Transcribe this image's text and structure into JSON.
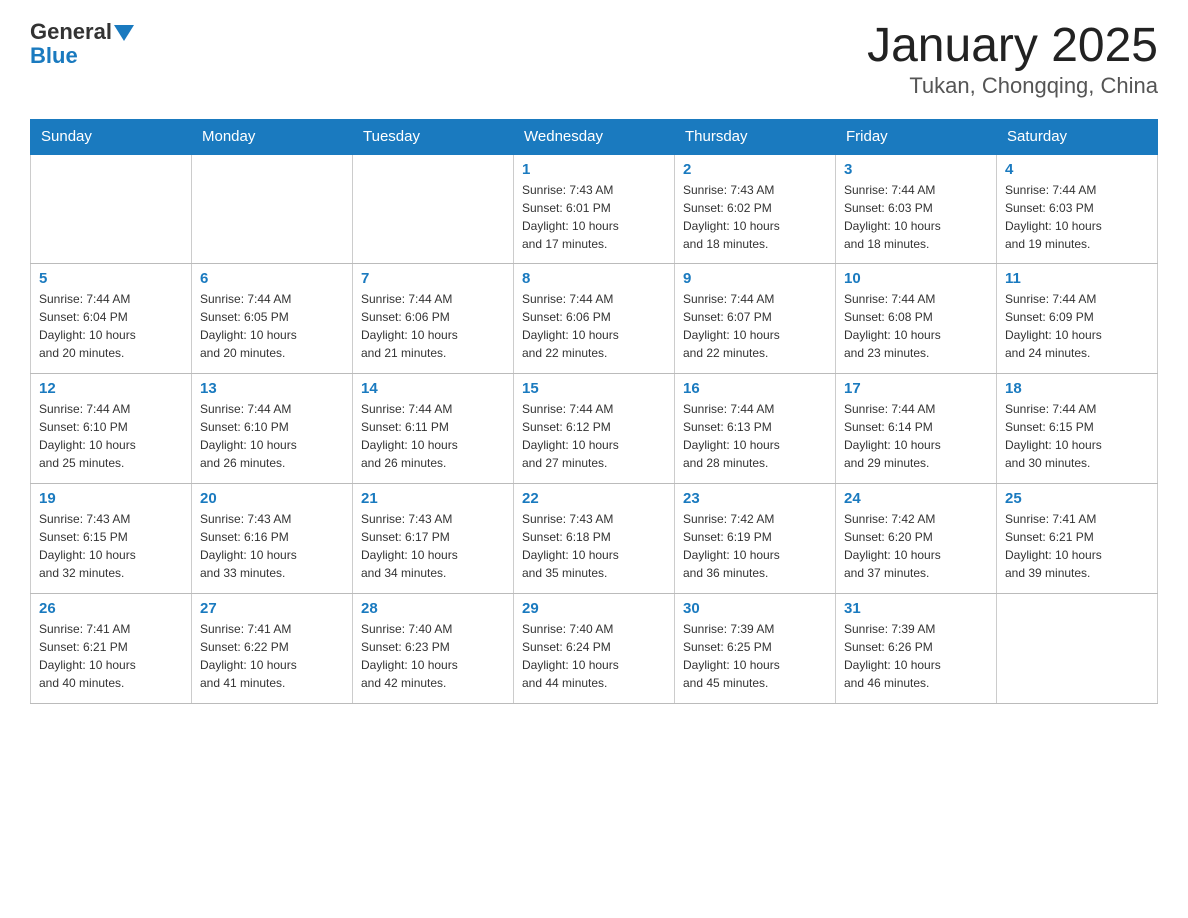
{
  "header": {
    "logo_general": "General",
    "logo_blue": "Blue",
    "title": "January 2025",
    "subtitle": "Tukan, Chongqing, China"
  },
  "weekdays": [
    "Sunday",
    "Monday",
    "Tuesday",
    "Wednesday",
    "Thursday",
    "Friday",
    "Saturday"
  ],
  "weeks": [
    [
      {
        "day": "",
        "info": ""
      },
      {
        "day": "",
        "info": ""
      },
      {
        "day": "",
        "info": ""
      },
      {
        "day": "1",
        "info": "Sunrise: 7:43 AM\nSunset: 6:01 PM\nDaylight: 10 hours\nand 17 minutes."
      },
      {
        "day": "2",
        "info": "Sunrise: 7:43 AM\nSunset: 6:02 PM\nDaylight: 10 hours\nand 18 minutes."
      },
      {
        "day": "3",
        "info": "Sunrise: 7:44 AM\nSunset: 6:03 PM\nDaylight: 10 hours\nand 18 minutes."
      },
      {
        "day": "4",
        "info": "Sunrise: 7:44 AM\nSunset: 6:03 PM\nDaylight: 10 hours\nand 19 minutes."
      }
    ],
    [
      {
        "day": "5",
        "info": "Sunrise: 7:44 AM\nSunset: 6:04 PM\nDaylight: 10 hours\nand 20 minutes."
      },
      {
        "day": "6",
        "info": "Sunrise: 7:44 AM\nSunset: 6:05 PM\nDaylight: 10 hours\nand 20 minutes."
      },
      {
        "day": "7",
        "info": "Sunrise: 7:44 AM\nSunset: 6:06 PM\nDaylight: 10 hours\nand 21 minutes."
      },
      {
        "day": "8",
        "info": "Sunrise: 7:44 AM\nSunset: 6:06 PM\nDaylight: 10 hours\nand 22 minutes."
      },
      {
        "day": "9",
        "info": "Sunrise: 7:44 AM\nSunset: 6:07 PM\nDaylight: 10 hours\nand 22 minutes."
      },
      {
        "day": "10",
        "info": "Sunrise: 7:44 AM\nSunset: 6:08 PM\nDaylight: 10 hours\nand 23 minutes."
      },
      {
        "day": "11",
        "info": "Sunrise: 7:44 AM\nSunset: 6:09 PM\nDaylight: 10 hours\nand 24 minutes."
      }
    ],
    [
      {
        "day": "12",
        "info": "Sunrise: 7:44 AM\nSunset: 6:10 PM\nDaylight: 10 hours\nand 25 minutes."
      },
      {
        "day": "13",
        "info": "Sunrise: 7:44 AM\nSunset: 6:10 PM\nDaylight: 10 hours\nand 26 minutes."
      },
      {
        "day": "14",
        "info": "Sunrise: 7:44 AM\nSunset: 6:11 PM\nDaylight: 10 hours\nand 26 minutes."
      },
      {
        "day": "15",
        "info": "Sunrise: 7:44 AM\nSunset: 6:12 PM\nDaylight: 10 hours\nand 27 minutes."
      },
      {
        "day": "16",
        "info": "Sunrise: 7:44 AM\nSunset: 6:13 PM\nDaylight: 10 hours\nand 28 minutes."
      },
      {
        "day": "17",
        "info": "Sunrise: 7:44 AM\nSunset: 6:14 PM\nDaylight: 10 hours\nand 29 minutes."
      },
      {
        "day": "18",
        "info": "Sunrise: 7:44 AM\nSunset: 6:15 PM\nDaylight: 10 hours\nand 30 minutes."
      }
    ],
    [
      {
        "day": "19",
        "info": "Sunrise: 7:43 AM\nSunset: 6:15 PM\nDaylight: 10 hours\nand 32 minutes."
      },
      {
        "day": "20",
        "info": "Sunrise: 7:43 AM\nSunset: 6:16 PM\nDaylight: 10 hours\nand 33 minutes."
      },
      {
        "day": "21",
        "info": "Sunrise: 7:43 AM\nSunset: 6:17 PM\nDaylight: 10 hours\nand 34 minutes."
      },
      {
        "day": "22",
        "info": "Sunrise: 7:43 AM\nSunset: 6:18 PM\nDaylight: 10 hours\nand 35 minutes."
      },
      {
        "day": "23",
        "info": "Sunrise: 7:42 AM\nSunset: 6:19 PM\nDaylight: 10 hours\nand 36 minutes."
      },
      {
        "day": "24",
        "info": "Sunrise: 7:42 AM\nSunset: 6:20 PM\nDaylight: 10 hours\nand 37 minutes."
      },
      {
        "day": "25",
        "info": "Sunrise: 7:41 AM\nSunset: 6:21 PM\nDaylight: 10 hours\nand 39 minutes."
      }
    ],
    [
      {
        "day": "26",
        "info": "Sunrise: 7:41 AM\nSunset: 6:21 PM\nDaylight: 10 hours\nand 40 minutes."
      },
      {
        "day": "27",
        "info": "Sunrise: 7:41 AM\nSunset: 6:22 PM\nDaylight: 10 hours\nand 41 minutes."
      },
      {
        "day": "28",
        "info": "Sunrise: 7:40 AM\nSunset: 6:23 PM\nDaylight: 10 hours\nand 42 minutes."
      },
      {
        "day": "29",
        "info": "Sunrise: 7:40 AM\nSunset: 6:24 PM\nDaylight: 10 hours\nand 44 minutes."
      },
      {
        "day": "30",
        "info": "Sunrise: 7:39 AM\nSunset: 6:25 PM\nDaylight: 10 hours\nand 45 minutes."
      },
      {
        "day": "31",
        "info": "Sunrise: 7:39 AM\nSunset: 6:26 PM\nDaylight: 10 hours\nand 46 minutes."
      },
      {
        "day": "",
        "info": ""
      }
    ]
  ]
}
